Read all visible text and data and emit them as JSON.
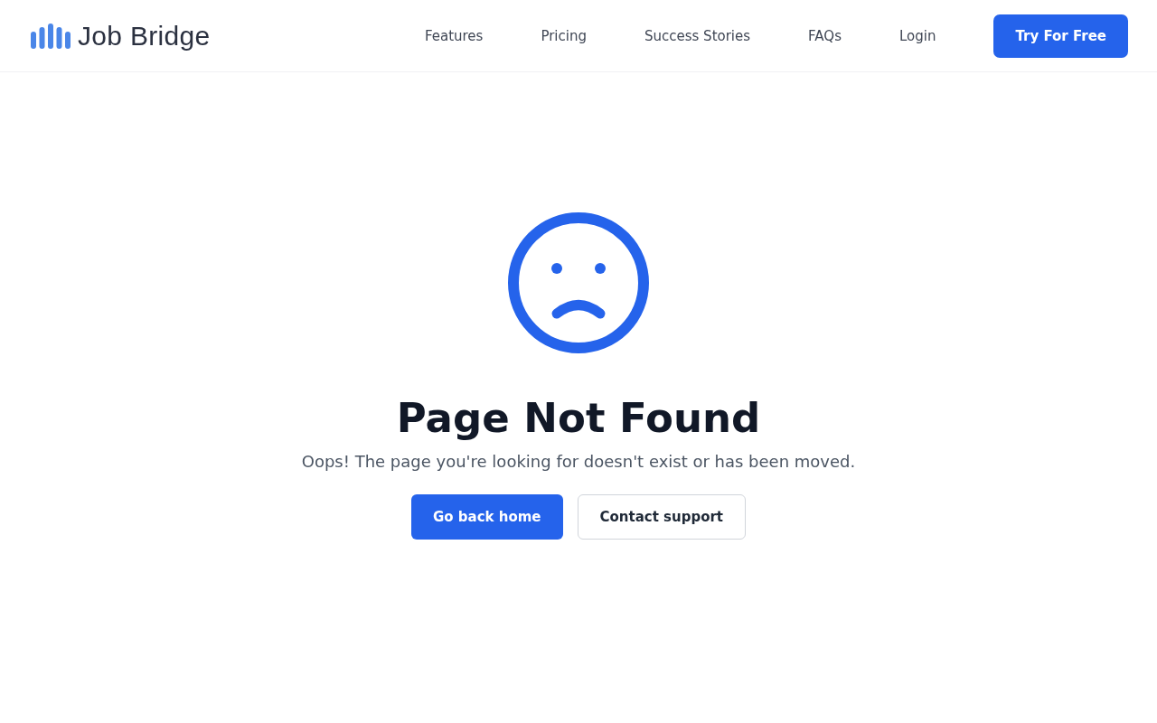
{
  "logo": {
    "text": "Job Bridge"
  },
  "nav": [
    {
      "label": "Features"
    },
    {
      "label": "Pricing"
    },
    {
      "label": "Success Stories"
    },
    {
      "label": "FAQs"
    },
    {
      "label": "Login"
    }
  ],
  "cta": {
    "label": "Try For Free"
  },
  "error": {
    "title": "Page Not Found",
    "message": "Oops! The page you're looking for doesn't exist or has been moved."
  },
  "actions": [
    {
      "label": "Go back home",
      "kind": "primary"
    },
    {
      "label": "Contact support",
      "kind": "secondary"
    }
  ]
}
